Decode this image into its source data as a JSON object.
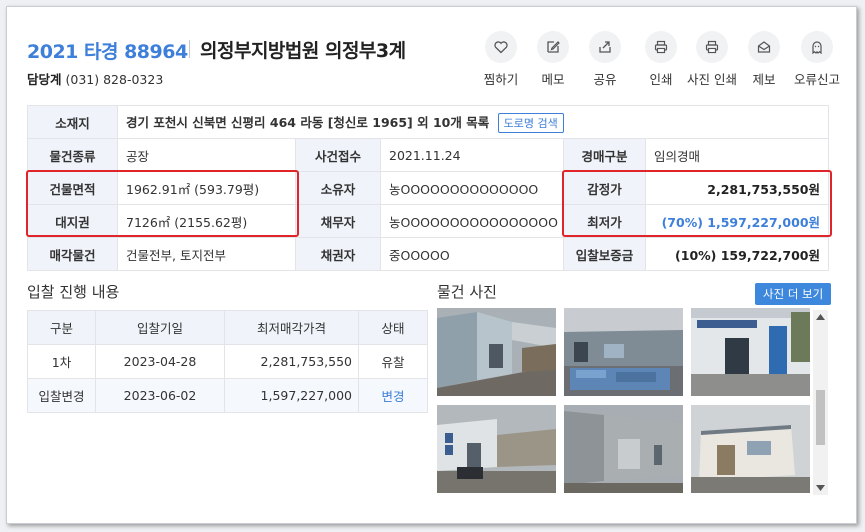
{
  "header": {
    "case_number": "2021 타경 88964",
    "court": "의정부지방법원 의정부3계",
    "contact_label": "담당계",
    "contact_phone": "(031) 828-0323"
  },
  "actions": [
    {
      "label": "찜하기",
      "icon": "heart-icon"
    },
    {
      "label": "메모",
      "icon": "memo-icon"
    },
    {
      "label": "공유",
      "icon": "share-icon"
    },
    {
      "label": "인쇄",
      "icon": "print-icon"
    },
    {
      "label": "사진 인쇄",
      "icon": "photo-print-icon"
    },
    {
      "label": "제보",
      "icon": "report-icon"
    },
    {
      "label": "오류신고",
      "icon": "error-report-icon"
    }
  ],
  "info": {
    "location_label": "소재지",
    "location_value": "경기 포천시 신북면 신평리 464 라동 [청신로 1965] 외 10개 목록",
    "road_search_label": "도로명 검색",
    "type_label": "물건종류",
    "type_value": "공장",
    "received_label": "사건접수",
    "received_value": "2021.11.24",
    "auction_type_label": "경매구분",
    "auction_type_value": "임의경매",
    "building_area_label": "건물면적",
    "building_area_value": "1962.91㎡ (593.79평)",
    "owner_label": "소유자",
    "owner_value": "농OOOOOOOOOOOOOO",
    "appraisal_label": "감정가",
    "appraisal_value": "2,281,753,550원",
    "land_right_label": "대지권",
    "land_right_value": "7126㎡ (2155.62평)",
    "debtor_label": "채무자",
    "debtor_value": "농OOOOOOOOOOOOOOOO",
    "min_price_label": "최저가",
    "min_price_value": "(70%) 1,597,227,000원",
    "sale_item_label": "매각물건",
    "sale_item_value": "건물전부, 토지전부",
    "creditor_label": "채권자",
    "creditor_value": "중OOOOO",
    "deposit_label": "입찰보증금",
    "deposit_value": "(10%) 159,722,700원"
  },
  "bidding": {
    "title": "입찰 진행 내용",
    "columns": [
      "구분",
      "입찰기일",
      "최저매각가격",
      "상태"
    ],
    "rows": [
      {
        "round": "1차",
        "date": "2023-04-28",
        "price": "2,281,753,550",
        "status": "유찰"
      },
      {
        "round": "입찰변경",
        "date": "2023-06-02",
        "price": "1,597,227,000",
        "status": "변경"
      }
    ]
  },
  "photos_section": {
    "title": "물건 사진",
    "more_label": "사진 더 보기"
  },
  "colors": {
    "accent": "#3d7fd9",
    "highlight_box": "#e0252a",
    "header_cell_bg": "#f0f4fa"
  }
}
